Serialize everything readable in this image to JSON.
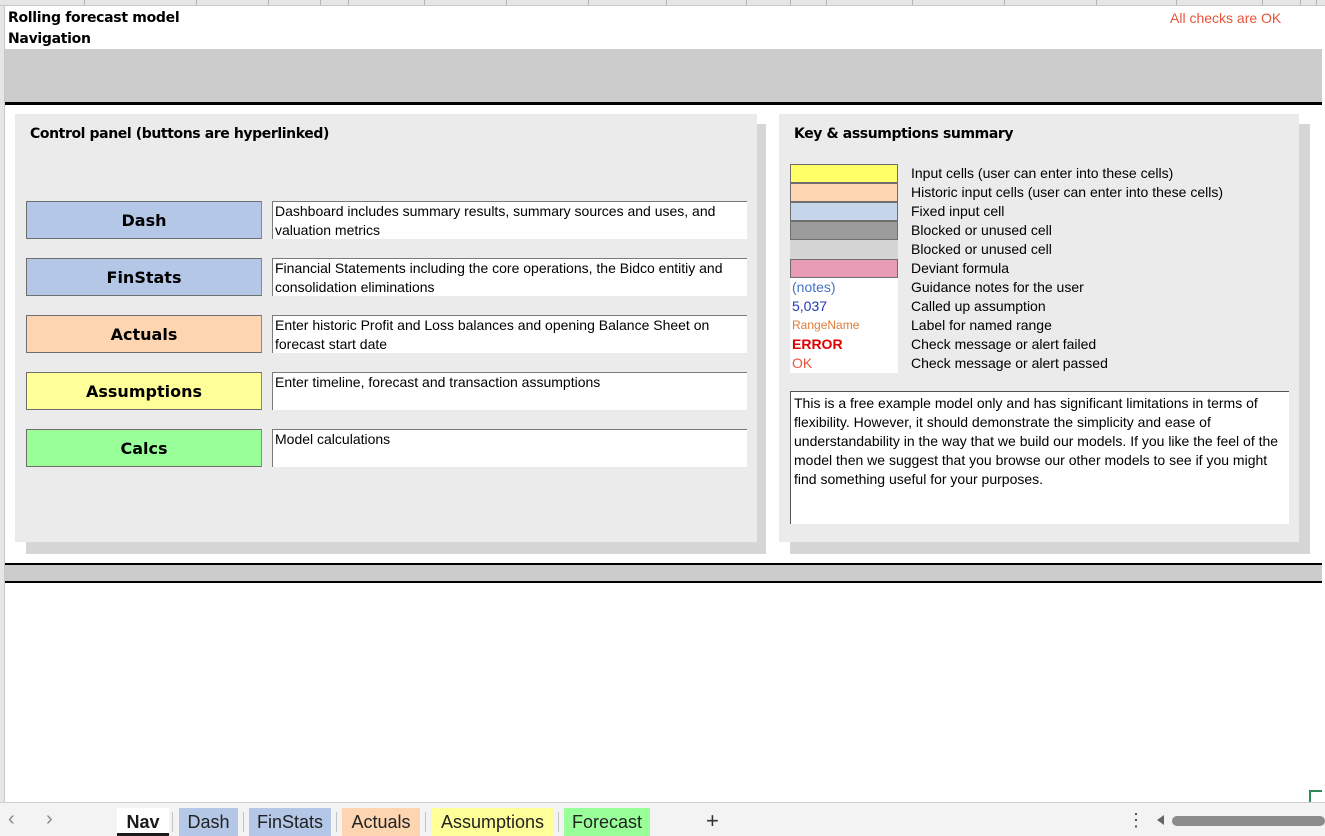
{
  "header": {
    "title": "Rolling forecast model",
    "subtitle": "Navigation",
    "checks_status": "All checks are OK",
    "checks_color": "#e8553a"
  },
  "control_panel": {
    "title": "Control panel (buttons are hyperlinked)",
    "buttons": [
      {
        "label": "Dash",
        "color": "#b4c7e7",
        "description": "Dashboard includes summary results, summary sources and uses, and valuation metrics"
      },
      {
        "label": "FinStats",
        "color": "#b4c7e7",
        "description": "Financial Statements including the core operations, the Bidco entitiy and consolidation eliminations"
      },
      {
        "label": "Actuals",
        "color": "#fdd5b1",
        "description": "Enter historic Profit and Loss balances and opening Balance Sheet on forecast start date"
      },
      {
        "label": "Assumptions",
        "color": "#ffff99",
        "description": "Enter timeline, forecast and transaction assumptions"
      },
      {
        "label": "Calcs",
        "color": "#99ff99",
        "description": "Model calculations"
      }
    ]
  },
  "key_panel": {
    "title": "Key & assumptions summary",
    "swatches": [
      {
        "color": "#ffff66",
        "label": "Input cells (user can enter into these cells)"
      },
      {
        "color": "#fdd5b1",
        "label": "Historic input cells (user can enter into these cells)"
      },
      {
        "color": "#c5d5ea",
        "label": "Fixed input cell"
      },
      {
        "color": "#9b9b9b",
        "label": "Blocked or unused cell"
      },
      {
        "color": "#d4d4d4",
        "label": "Blocked or unused cell"
      },
      {
        "color": "#e89bb4",
        "label": "Deviant formula"
      }
    ],
    "text_keys": [
      {
        "sample": "(notes)",
        "color": "#4472c4",
        "label": "Guidance notes for the user"
      },
      {
        "sample": "5,037",
        "color": "#1f3bb3",
        "label": "Called up assumption"
      },
      {
        "sample": "RangeName",
        "color": "#e07b39",
        "label": "Label for named range"
      },
      {
        "sample": "ERROR",
        "color": "#e00000",
        "label": "Check message or alert failed"
      },
      {
        "sample": "OK",
        "color": "#e8553a",
        "label": "Check message or alert passed"
      }
    ],
    "disclaimer": "This is a free example model only and has significant limitations in terms of flexibility. However, it should demonstrate the simplicity and ease of understandability in the way that we build our models. If you like the feel of the model then we suggest that you browse our other models to see if you might find something useful for your purposes."
  },
  "sheet_tabs": {
    "prev_icon": "chevron-left-icon",
    "next_icon": "chevron-right-icon",
    "tabs": [
      {
        "label": "Nav",
        "color": "#ffffff",
        "active": true
      },
      {
        "label": "Dash",
        "color": "#b4c7e7"
      },
      {
        "label": "FinStats",
        "color": "#b4c7e7"
      },
      {
        "label": "Actuals",
        "color": "#fdd5b1"
      },
      {
        "label": "Assumptions",
        "color": "#ffff99"
      },
      {
        "label": "Forecast",
        "color": "#99ff99"
      }
    ],
    "add_label": "+",
    "more_label": "⋮"
  }
}
